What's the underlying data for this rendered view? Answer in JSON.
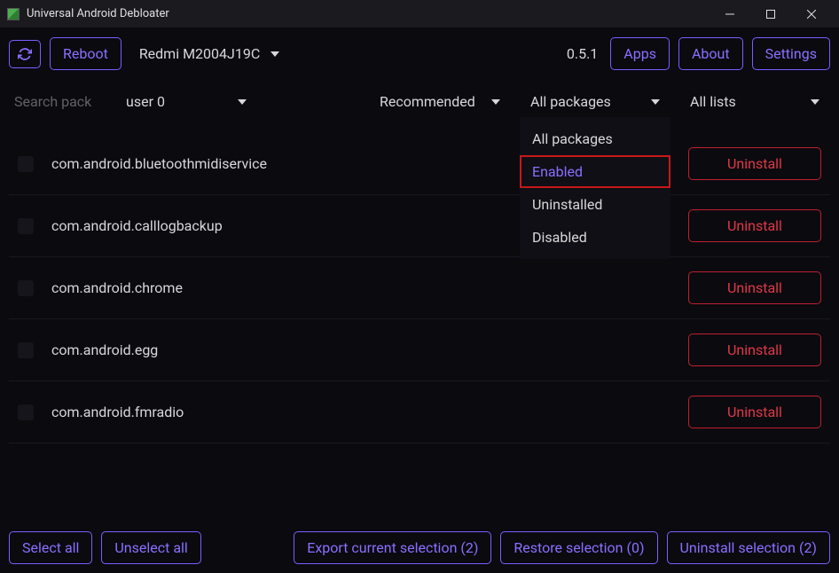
{
  "titlebar": {
    "title": "Universal Android Debloater"
  },
  "toolbar": {
    "reboot_label": "Reboot",
    "device_label": "Redmi M2004J19C",
    "version": "0.5.1",
    "apps_label": "Apps",
    "about_label": "About",
    "settings_label": "Settings"
  },
  "filters": {
    "search_placeholder": "Search pack",
    "user_label": "user 0",
    "category_label": "Recommended",
    "status_label": "All packages",
    "list_label": "All lists",
    "status_options": [
      {
        "label": "All packages",
        "highlighted": false
      },
      {
        "label": "Enabled",
        "highlighted": true
      },
      {
        "label": "Uninstalled",
        "highlighted": false
      },
      {
        "label": "Disabled",
        "highlighted": false
      }
    ]
  },
  "packages": [
    {
      "name": "com.android.bluetoothmidiservice",
      "action": "Uninstall"
    },
    {
      "name": "com.android.calllogbackup",
      "action": "Uninstall"
    },
    {
      "name": "com.android.chrome",
      "action": "Uninstall"
    },
    {
      "name": "com.android.egg",
      "action": "Uninstall"
    },
    {
      "name": "com.android.fmradio",
      "action": "Uninstall"
    }
  ],
  "bottom": {
    "select_all": "Select all",
    "unselect_all": "Unselect all",
    "export": "Export current selection (2)",
    "restore": "Restore selection (0)",
    "uninstall": "Uninstall selection (2)"
  }
}
